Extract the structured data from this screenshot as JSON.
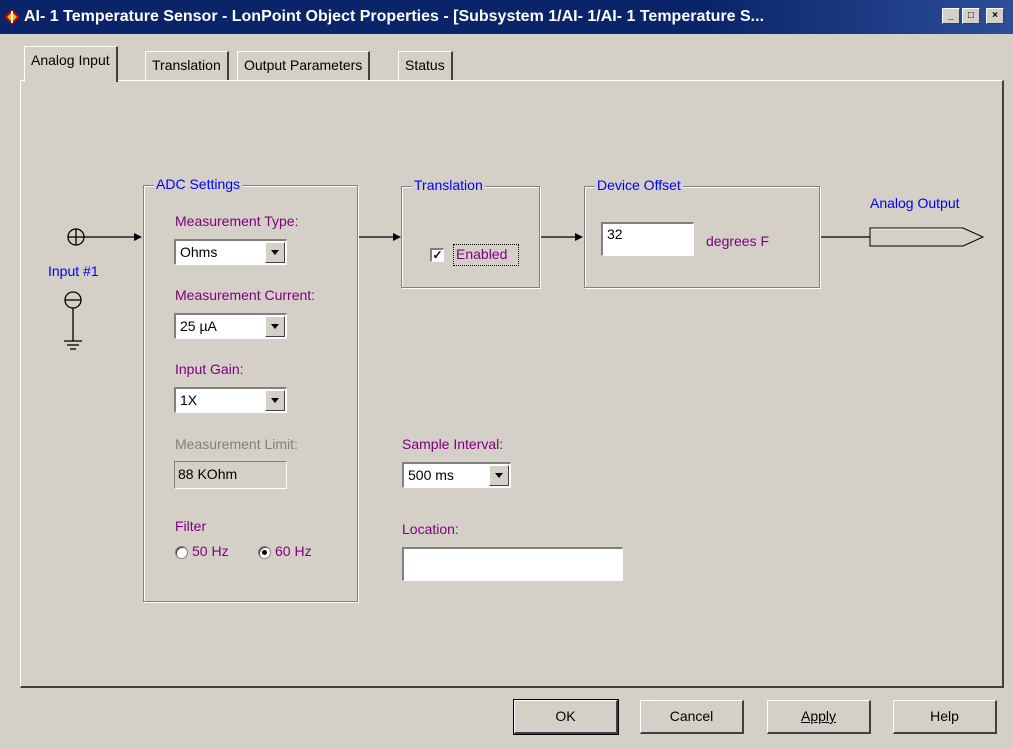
{
  "window": {
    "title": "AI- 1 Temperature Sensor - LonPoint Object Properties - [Subsystem 1/AI- 1/AI- 1 Temperature S...",
    "minimize": "_",
    "maximize": "□",
    "close": "×"
  },
  "tabs": [
    {
      "label": "Analog Input",
      "active": true
    },
    {
      "label": "Translation",
      "active": false
    },
    {
      "label": "Output Parameters",
      "active": false
    },
    {
      "label": "Status",
      "active": false
    }
  ],
  "input": {
    "label": "Input #1"
  },
  "adc": {
    "title": "ADC Settings",
    "measurement_type_label": "Measurement Type:",
    "measurement_type_value": "Ohms",
    "measurement_current_label": "Measurement Current:",
    "measurement_current_value": "25 µA",
    "input_gain_label": "Input Gain:",
    "input_gain_value": "1X",
    "measurement_limit_label": "Measurement Limit:",
    "measurement_limit_value": "88 KOhm",
    "filter_label": "Filter",
    "filter_options": [
      {
        "label": "50 Hz",
        "selected": false
      },
      {
        "label": "60 Hz",
        "selected": true
      }
    ]
  },
  "translation": {
    "title": "Translation",
    "enabled_label": "Enabled",
    "enabled": true
  },
  "device_offset": {
    "title": "Device Offset",
    "value": "32",
    "unit": "degrees F"
  },
  "output": {
    "label": "Analog Output"
  },
  "sample_interval": {
    "label": "Sample Interval:",
    "value": "500 ms"
  },
  "location": {
    "label": "Location:",
    "value": ""
  },
  "buttons": {
    "ok": "OK",
    "cancel": "Cancel",
    "apply": "Apply",
    "help": "Help"
  },
  "colors": {
    "titlebar": "#0a246a",
    "face": "#d4d0c8",
    "label_purple": "#800080",
    "label_blue": "#0000ff"
  }
}
